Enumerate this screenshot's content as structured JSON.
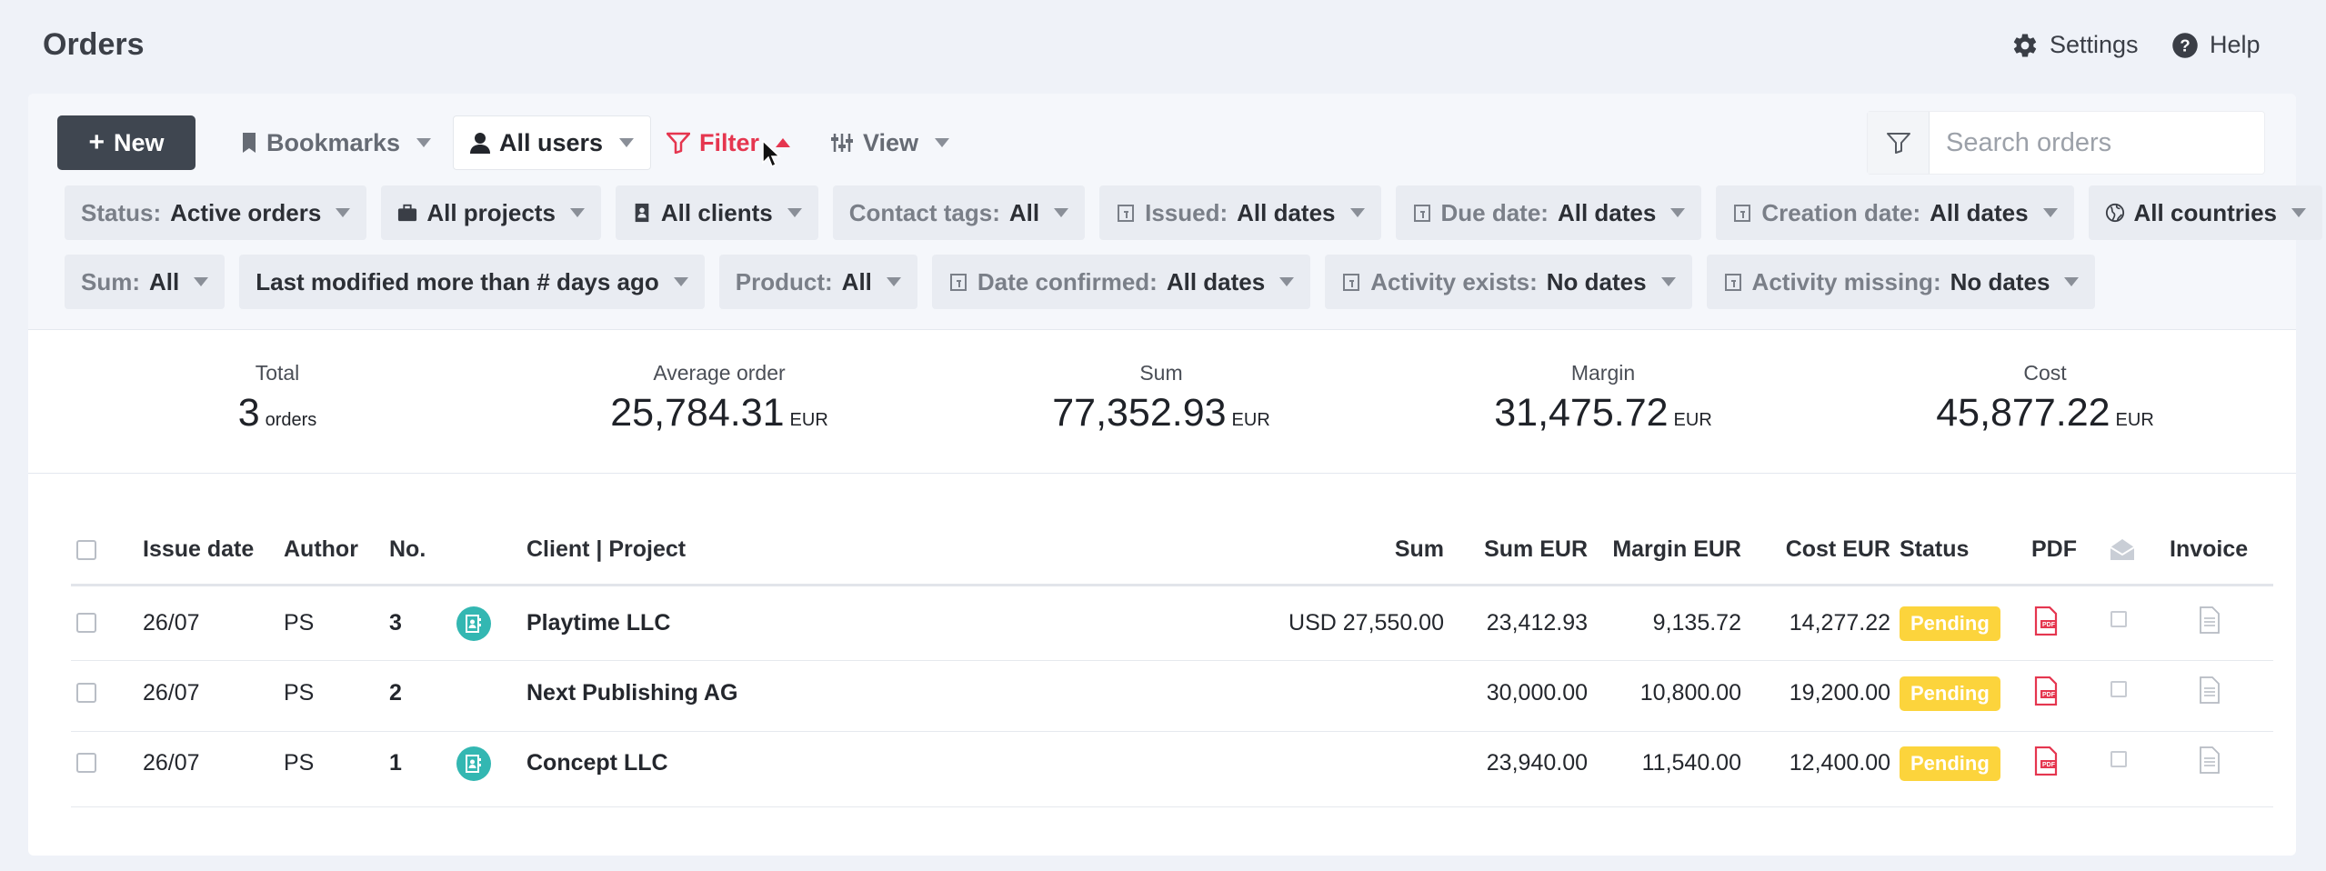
{
  "header": {
    "title": "Orders",
    "settings_label": "Settings",
    "help_label": "Help"
  },
  "toolbar": {
    "new_label": "New",
    "bookmarks_label": "Bookmarks",
    "users_label": "All users",
    "filter_label": "Filter",
    "view_label": "View",
    "search_placeholder": "Search orders"
  },
  "filters": {
    "row1": [
      {
        "label": "Status:",
        "value": "Active orders",
        "icon": "none"
      },
      {
        "label": "",
        "value": "All projects",
        "icon": "briefcase-icon"
      },
      {
        "label": "",
        "value": "All clients",
        "icon": "contact-book-icon"
      },
      {
        "label": "Contact tags:",
        "value": "All",
        "icon": "none"
      },
      {
        "label": "Issued:",
        "value": "All dates",
        "icon": "calendar-icon"
      },
      {
        "label": "Due date:",
        "value": "All dates",
        "icon": "calendar-icon"
      },
      {
        "label": "Creation date:",
        "value": "All dates",
        "icon": "calendar-icon"
      },
      {
        "label": "",
        "value": "All countries",
        "icon": "globe-icon"
      }
    ],
    "row2": [
      {
        "label": "Sum:",
        "value": "All",
        "icon": "none"
      },
      {
        "label": "",
        "value": "Last modified more than # days ago",
        "icon": "none"
      },
      {
        "label": "Product:",
        "value": "All",
        "icon": "none"
      },
      {
        "label": "Date confirmed:",
        "value": "All dates",
        "icon": "calendar-icon"
      },
      {
        "label": "Activity exists:",
        "value": "No dates",
        "icon": "calendar-icon"
      },
      {
        "label": "Activity missing:",
        "value": "No dates",
        "icon": "calendar-icon"
      }
    ]
  },
  "stats": {
    "total": {
      "label": "Total",
      "value": "3",
      "unit": "orders"
    },
    "average": {
      "label": "Average order",
      "value": "25,784.31",
      "unit": "EUR"
    },
    "sum": {
      "label": "Sum",
      "value": "77,352.93",
      "unit": "EUR"
    },
    "margin": {
      "label": "Margin",
      "value": "31,475.72",
      "unit": "EUR"
    },
    "cost": {
      "label": "Cost",
      "value": "45,877.22",
      "unit": "EUR"
    }
  },
  "table": {
    "headers": {
      "issue_date": "Issue date",
      "author": "Author",
      "no": "No.",
      "client": "Client | Project",
      "sum": "Sum",
      "sum_eur": "Sum EUR",
      "margin_eur": "Margin EUR",
      "cost_eur": "Cost EUR",
      "status": "Status",
      "pdf": "PDF",
      "invoice": "Invoice"
    },
    "rows": [
      {
        "date": "26/07",
        "author": "PS",
        "no": "3",
        "client": "Playtime LLC",
        "sum": "USD 27,550.00",
        "sum_eur": "23,412.93",
        "margin_eur": "9,135.72",
        "cost_eur": "14,277.22",
        "status": "Pending",
        "has_icon": true
      },
      {
        "date": "26/07",
        "author": "PS",
        "no": "2",
        "client": "Next Publishing AG",
        "sum": "",
        "sum_eur": "30,000.00",
        "margin_eur": "10,800.00",
        "cost_eur": "19,200.00",
        "status": "Pending",
        "has_icon": false
      },
      {
        "date": "26/07",
        "author": "PS",
        "no": "1",
        "client": "Concept LLC",
        "sum": "",
        "sum_eur": "23,940.00",
        "margin_eur": "11,540.00",
        "cost_eur": "12,400.00",
        "status": "Pending",
        "has_icon": true
      }
    ]
  },
  "colors": {
    "accent_red": "#e5364f",
    "pending_badge": "#fcd43c",
    "client_icon": "#33b7b2",
    "new_button": "#3f4650"
  }
}
